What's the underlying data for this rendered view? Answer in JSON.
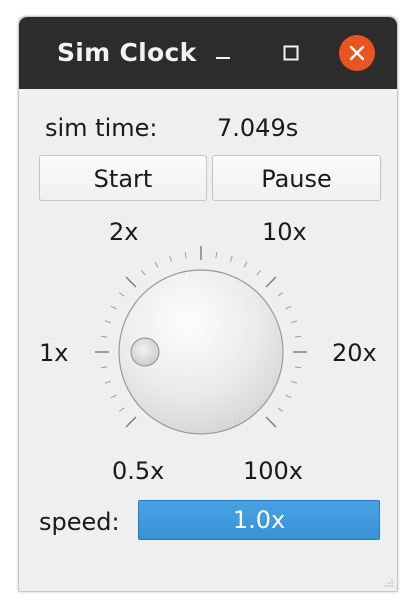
{
  "window": {
    "title": "Sim Clock",
    "controls": {
      "minimize": "minimize-icon",
      "maximize": "maximize-icon",
      "close": "close-icon"
    },
    "close_color": "#e95420",
    "titlebar_color": "#2c2c2c"
  },
  "sim_time": {
    "label": "sim time:",
    "value": "7.049s"
  },
  "buttons": {
    "start": "Start",
    "pause": "Pause"
  },
  "dial": {
    "labels": {
      "half": "0.5x",
      "one": "1x",
      "two": "2x",
      "ten": "10x",
      "twenty": "20x",
      "hundred": "100x"
    },
    "selected": "1x"
  },
  "speed": {
    "label": "speed:",
    "value": "1.0x",
    "fill_fraction": 1.0,
    "bar_color": "#3d95d8"
  }
}
